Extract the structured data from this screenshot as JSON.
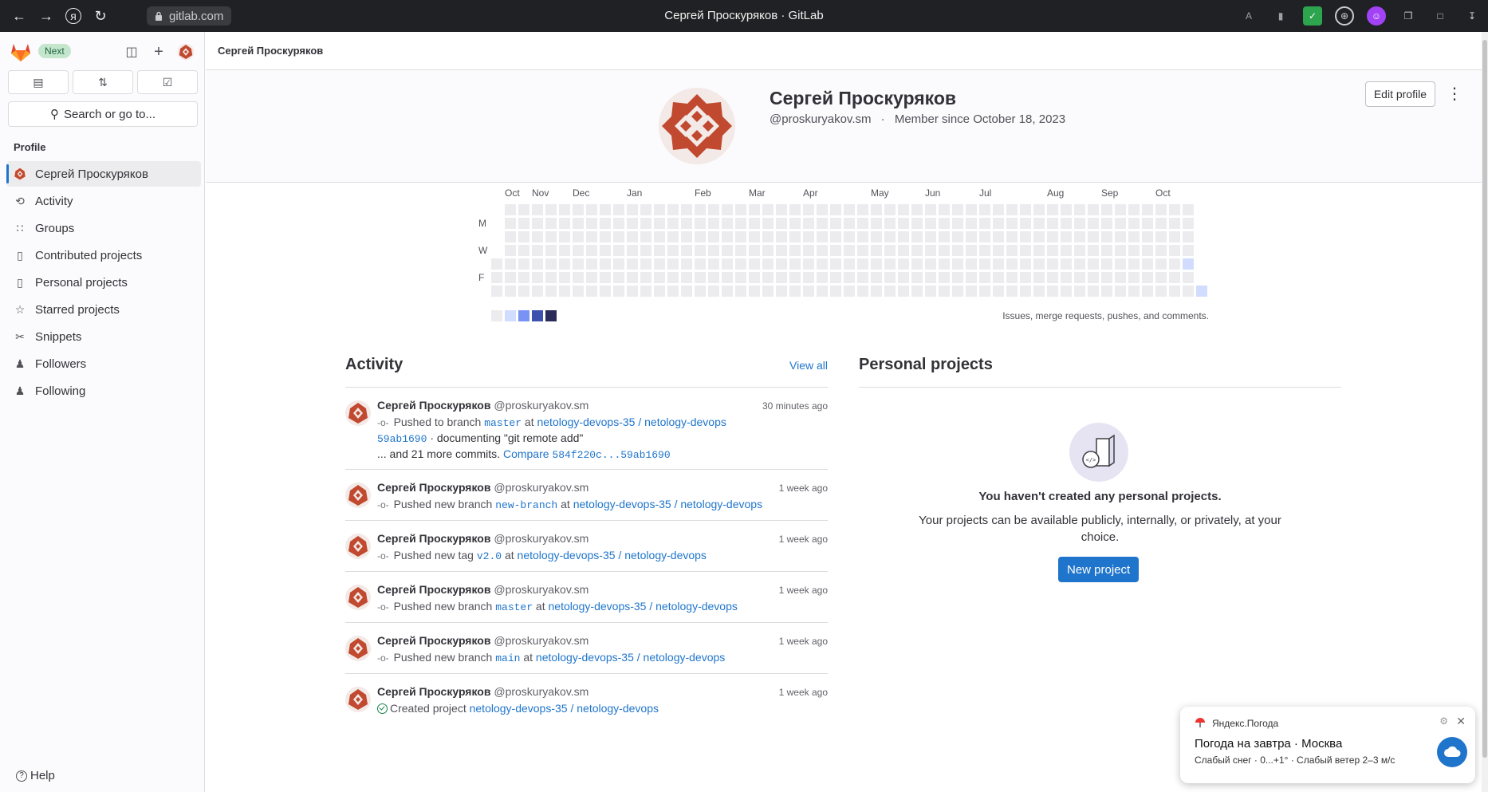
{
  "browser": {
    "url": "gitlab.com",
    "title": "Сергей Проскуряков · GitLab"
  },
  "sidebar": {
    "badge": "Next",
    "search_label": "Search or go to...",
    "section_title": "Profile",
    "items": [
      {
        "label": "Сергей Проскуряков",
        "icon": "user-avatar",
        "active": true
      },
      {
        "label": "Activity",
        "icon": "history-icon"
      },
      {
        "label": "Groups",
        "icon": "group-icon"
      },
      {
        "label": "Contributed projects",
        "icon": "project-icon"
      },
      {
        "label": "Personal projects",
        "icon": "project-icon"
      },
      {
        "label": "Starred projects",
        "icon": "star-icon"
      },
      {
        "label": "Snippets",
        "icon": "snippet-icon"
      },
      {
        "label": "Followers",
        "icon": "users-icon"
      },
      {
        "label": "Following",
        "icon": "users-icon"
      }
    ],
    "help_label": "Help"
  },
  "breadcrumb": "Сергей Проскуряков",
  "profile": {
    "name": "Сергей Проскуряков",
    "username": "@proskuryakov.sm",
    "separator": "·",
    "member_since": "Member since October 18, 2023",
    "edit_label": "Edit profile"
  },
  "calendar": {
    "months": [
      "Oct",
      "Nov",
      "Dec",
      "Jan",
      "Feb",
      "Mar",
      "Apr",
      "May",
      "Jun",
      "Jul",
      "Aug",
      "Sep",
      "Oct"
    ],
    "days": [
      "M",
      "W",
      "F"
    ],
    "weeks": 53,
    "active_cells": [
      {
        "week": 51,
        "day": 4,
        "level": 1
      },
      {
        "week": 52,
        "day": 6,
        "level": 1
      }
    ],
    "legend_colors": [
      "#ececef",
      "#d2dcff",
      "#7992f5",
      "#3f51ae",
      "#2a2b59"
    ],
    "note": "Issues, merge requests, pushes, and comments."
  },
  "activity": {
    "title": "Activity",
    "view_all": "View all",
    "events": [
      {
        "name": "Сергей Проскуряков",
        "handle": "@proskuryakov.sm",
        "time": "30 minutes ago",
        "action": "Pushed to branch",
        "ref": "master",
        "at": "at",
        "project": "netology-devops-35 / netology-devops",
        "commit_sha": "59ab1690",
        "commit_msg": "· documenting \"git remote add\"",
        "more": "... and 21 more commits.",
        "compare_label": "Compare",
        "compare_range": "584f220c...59ab1690"
      },
      {
        "name": "Сергей Проскуряков",
        "handle": "@proskuryakov.sm",
        "time": "1 week ago",
        "action": "Pushed new branch",
        "ref": "new-branch",
        "at": "at",
        "project": "netology-devops-35 / netology-devops"
      },
      {
        "name": "Сергей Проскуряков",
        "handle": "@proskuryakov.sm",
        "time": "1 week ago",
        "action": "Pushed new tag",
        "ref": "v2.0",
        "at": "at",
        "project": "netology-devops-35 / netology-devops"
      },
      {
        "name": "Сергей Проскуряков",
        "handle": "@proskuryakov.sm",
        "time": "1 week ago",
        "action": "Pushed new branch",
        "ref": "master",
        "at": "at",
        "project": "netology-devops-35 / netology-devops"
      },
      {
        "name": "Сергей Проскуряков",
        "handle": "@proskuryakov.sm",
        "time": "1 week ago",
        "action": "Pushed new branch",
        "ref": "main",
        "at": "at",
        "project": "netology-devops-35 / netology-devops"
      },
      {
        "name": "Сергей Проскуряков",
        "handle": "@proskuryakov.sm",
        "time": "1 week ago",
        "action": "Created project",
        "project": "netology-devops-35 / netology-devops"
      }
    ]
  },
  "projects": {
    "title": "Personal projects",
    "empty_title": "You haven't created any personal projects.",
    "empty_desc": "Your projects can be available publicly, internally, or privately, at your choice.",
    "new_project": "New project"
  },
  "notification": {
    "source": "Яндекс.Погода",
    "title": "Погода на завтра · Москва",
    "text": "Слабый снег · 0...+1° · Слабый ветер 2–3 м/с"
  },
  "colors": {
    "accent": "#1f75cb",
    "avatar": "#c0492f"
  }
}
